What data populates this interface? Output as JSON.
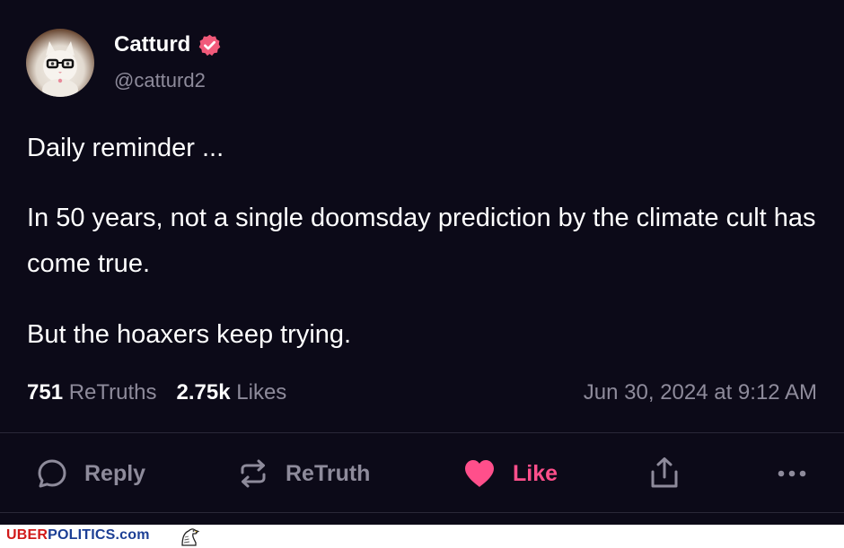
{
  "post": {
    "author": {
      "name": "Catturd",
      "handle": "@catturd2",
      "verified": true
    },
    "paragraphs": [
      "Daily reminder ...",
      "In 50 years, not a single doomsday prediction by the climate cult has come true.",
      "But the hoaxers keep trying."
    ],
    "stats": {
      "retruths_count": "751",
      "retruths_label": "ReTruths",
      "likes_count": "2.75k",
      "likes_label": "Likes"
    },
    "timestamp": "Jun 30, 2024 at 9:12 AM"
  },
  "actions": {
    "reply": "Reply",
    "retruth": "ReTruth",
    "like": "Like"
  },
  "footer": {
    "brand_uber": "UBER",
    "brand_politics": "POLITICS",
    "brand_com": ".com"
  },
  "colors": {
    "background": "#0c0a18",
    "muted_text": "#8e8b9b",
    "like_pink": "#ff4f8b",
    "verified_badge": "#f15a7a",
    "brand_red": "#d11a1a",
    "brand_blue": "#1c3f95"
  },
  "icons": {
    "verified": "verified-badge-icon",
    "reply": "speech-bubble-icon",
    "retruth": "repost-arrows-icon",
    "like": "heart-icon",
    "share": "share-upload-icon",
    "more": "more-dots-icon",
    "mascot": "eagle-icon"
  }
}
